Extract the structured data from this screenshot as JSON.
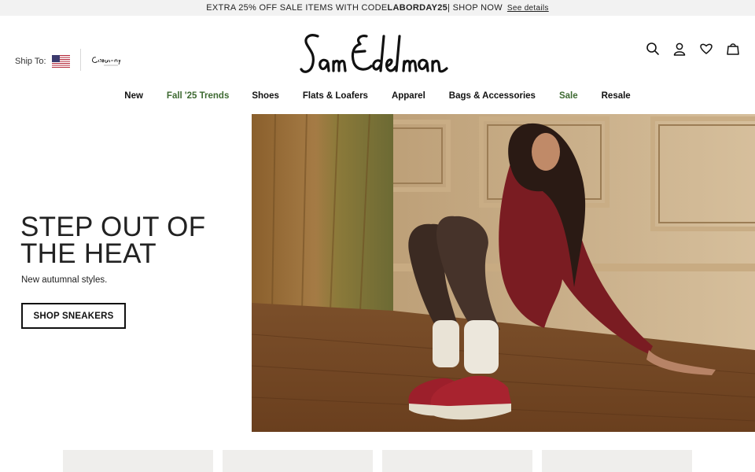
{
  "promo": {
    "text": "EXTRA 25% OFF SALE ITEMS WITH CODE ",
    "code": "LABORDAY25",
    "shop": " | SHOP NOW",
    "details": "See details"
  },
  "header": {
    "ship_to_label": "Ship To:",
    "flag_icon": "us-flag-icon",
    "circus_logo": "Circus NY",
    "circus_sub": "by Sam Edelman",
    "brand": "Sam Edelman",
    "icons": [
      "search-icon",
      "account-icon",
      "heart-icon",
      "bag-icon"
    ]
  },
  "nav": {
    "items": [
      {
        "label": "New",
        "accent": false
      },
      {
        "label": "Fall '25 Trends",
        "accent": true
      },
      {
        "label": "Shoes",
        "accent": false
      },
      {
        "label": "Flats & Loafers",
        "accent": false
      },
      {
        "label": "Apparel",
        "accent": false
      },
      {
        "label": "Bags & Accessories",
        "accent": false
      },
      {
        "label": "Sale",
        "accent": true
      },
      {
        "label": "Resale",
        "accent": false
      }
    ],
    "accent_color": "#3e6a32"
  },
  "hero": {
    "title": "STEP OUT OF THE HEAT",
    "subtitle": "New autumnal styles.",
    "cta": "SHOP SNEAKERS"
  }
}
